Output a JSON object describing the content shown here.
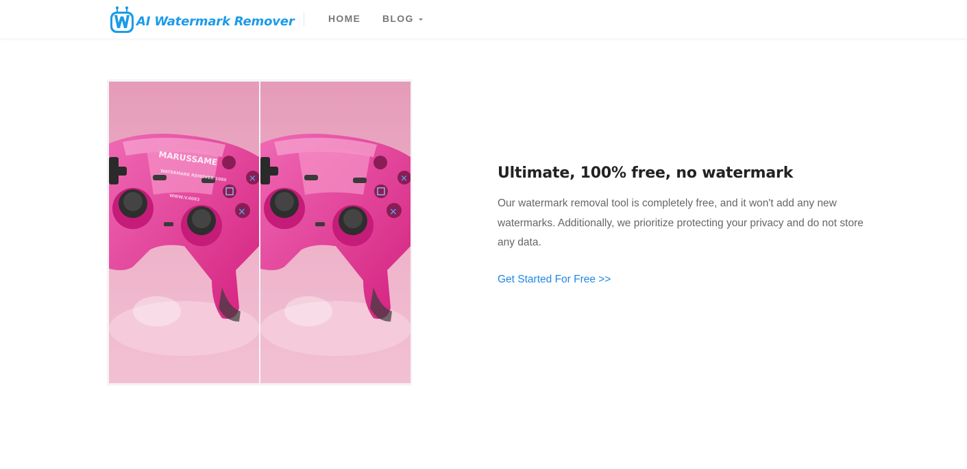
{
  "header": {
    "logo_text": "AI Watermark Remover",
    "logo_icon": "robot-w-icon",
    "nav": {
      "home": "HOME",
      "blog": "BLOG"
    }
  },
  "compare": {
    "before_watermark_lines": [
      "MARUSSAME",
      "WATERMARK REMOVER 1080",
      "WWW.V.0083"
    ]
  },
  "feature": {
    "title": "Ultimate, 100% free, no watermark",
    "description": "Our watermark removal tool is completely free, and it won't add any new watermarks. Additionally, we prioritize protecting your privacy and do not store any data.",
    "cta": "Get Started For Free >>"
  },
  "colors": {
    "brand": "#1c9be8",
    "link": "#1e88e5",
    "nav_text": "#777777",
    "photo_background": "#e8a9c1",
    "controller_pink": "#e0298e"
  }
}
